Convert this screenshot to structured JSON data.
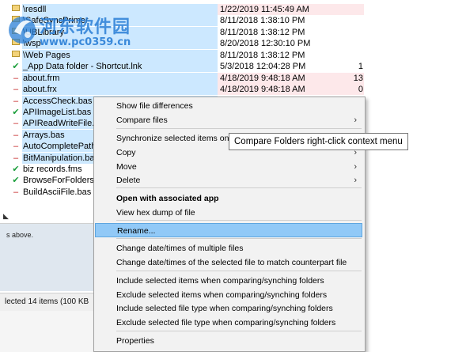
{
  "watermark": {
    "title": "河东软件园",
    "url": "www.pc0359.cn"
  },
  "file_rows": [
    {
      "mark": "",
      "name": "\\resdll",
      "date": "1/22/2019 11:45:49 AM",
      "count": "",
      "selected": true,
      "diff": true
    },
    {
      "mark": "",
      "name": "\\SafeSyncPrimer",
      "date": "8/11/2018 1:38:10 PM",
      "count": "",
      "selected": true,
      "diff": false
    },
    {
      "mark": "",
      "name": "\\UBLibrary",
      "date": "8/11/2018 1:38:12 PM",
      "count": "",
      "selected": true,
      "diff": false
    },
    {
      "mark": "",
      "name": "\\wsp",
      "date": "8/20/2018 12:30:10 PM",
      "count": "",
      "selected": true,
      "diff": false
    },
    {
      "mark": "",
      "name": "\\Web Pages",
      "date": "8/11/2018 1:38:12 PM",
      "count": "",
      "selected": true,
      "diff": false
    },
    {
      "mark": "✔",
      "name": "_App Data folder - Shortcut.lnk",
      "date": "5/3/2018 12:04:28 PM",
      "count": "1",
      "selected": true,
      "diff": false
    },
    {
      "mark": "–",
      "name": "about.frm",
      "date": "4/18/2019 9:48:18 AM",
      "count": "13",
      "selected": true,
      "diff": true
    },
    {
      "mark": "–",
      "name": "about.frx",
      "date": "4/18/2019 9:48:18 AM",
      "count": "0",
      "selected": true,
      "diff": true
    },
    {
      "mark": "–",
      "name": "AccessCheck.bas",
      "date": "",
      "count": "",
      "selected": true,
      "diff": false
    },
    {
      "mark": "✔",
      "name": "APIImageList.bas",
      "date": "",
      "count": "",
      "selected": true,
      "diff": false
    },
    {
      "mark": "–",
      "name": "APIReadWriteFile.bas",
      "date": "",
      "count": "",
      "selected": true,
      "diff": false
    },
    {
      "mark": "–",
      "name": "Arrays.bas",
      "date": "",
      "count": "",
      "selected": true,
      "diff": false
    },
    {
      "mark": "–",
      "name": "AutoCompletePath.bas",
      "date": "",
      "count": "",
      "selected": true,
      "diff": false
    },
    {
      "mark": "–",
      "name": "BitManipulation.bas",
      "date": "",
      "count": "",
      "selected": true,
      "diff": false
    },
    {
      "mark": "✔",
      "name": "biz records.fms",
      "date": "",
      "count": "",
      "selected": false,
      "diff": false
    },
    {
      "mark": "✔",
      "name": "BrowseForFolders.frm",
      "date": "",
      "count": "",
      "selected": false,
      "diff": false
    },
    {
      "mark": "–",
      "name": "BuildAsciiFile.bas",
      "date": "",
      "count": "",
      "selected": false,
      "diff": false
    }
  ],
  "lower_pane": {
    "info": "s above.",
    "status": "lected 14 items (100 KB"
  },
  "context_menu": {
    "items": [
      {
        "label": "Show file differences",
        "arrow": false,
        "bold": false,
        "highlight": false
      },
      {
        "label": "Compare files",
        "arrow": true,
        "bold": false,
        "highlight": false
      },
      {
        "label": "Synchronize selected items only",
        "arrow": false,
        "bold": false,
        "highlight": false
      },
      {
        "label": "Copy",
        "arrow": true,
        "bold": false,
        "highlight": false
      },
      {
        "label": "Move",
        "arrow": true,
        "bold": false,
        "highlight": false
      },
      {
        "label": "Delete",
        "arrow": true,
        "bold": false,
        "highlight": false
      },
      {
        "label": "Open with associated app",
        "arrow": false,
        "bold": true,
        "highlight": false
      },
      {
        "label": "View hex dump of file",
        "arrow": false,
        "bold": false,
        "highlight": false
      },
      {
        "label": "Rename...",
        "arrow": false,
        "bold": false,
        "highlight": true
      },
      {
        "label": "Change date/times of multiple files",
        "arrow": false,
        "bold": false,
        "highlight": false
      },
      {
        "label": "Change date/times of the selected file to match counterpart file",
        "arrow": false,
        "bold": false,
        "highlight": false
      },
      {
        "label": "Include selected items when comparing/synching folders",
        "arrow": false,
        "bold": false,
        "highlight": false
      },
      {
        "label": "Exclude selected items when comparing/synching folders",
        "arrow": false,
        "bold": false,
        "highlight": false
      },
      {
        "label": "Include selected file type when comparing/synching folders",
        "arrow": false,
        "bold": false,
        "highlight": false
      },
      {
        "label": "Exclude selected file type when comparing/synching folders",
        "arrow": false,
        "bold": false,
        "highlight": false
      },
      {
        "label": "Properties",
        "arrow": false,
        "bold": false,
        "highlight": false
      }
    ]
  },
  "tooltip": "Compare Folders right-click context menu",
  "colors": {
    "selection": "#cce8ff",
    "diff_row": "#fde8ea",
    "menu_highlight": "#91c9f7",
    "check": "#1a9e3a",
    "dash": "#c21a1a",
    "watermark": "#2b7fd6"
  }
}
